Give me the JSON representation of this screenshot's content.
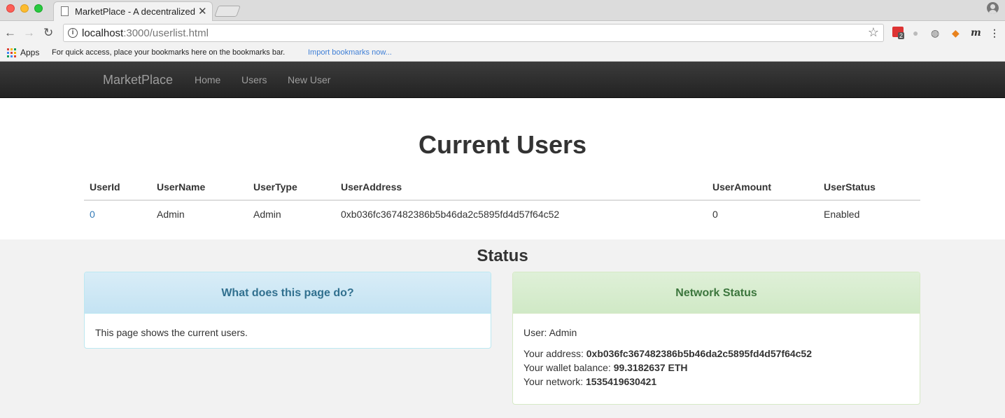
{
  "browser": {
    "tab_title": "MarketPlace - A decentralized",
    "url_host": "localhost",
    "url_rest": ":3000/userlist.html",
    "extension_badge": "2",
    "bookmarks": {
      "apps_label": "Apps",
      "hint": "For quick access, place your bookmarks here on the bookmarks bar.",
      "import_link": "Import bookmarks now..."
    }
  },
  "navbar": {
    "brand": "MarketPlace",
    "links": [
      "Home",
      "Users",
      "New User"
    ]
  },
  "page": {
    "title": "Current Users",
    "table": {
      "headers": [
        "UserId",
        "UserName",
        "UserType",
        "UserAddress",
        "UserAmount",
        "UserStatus"
      ],
      "rows": [
        [
          "0",
          "Admin",
          "Admin",
          "0xb036fc367482386b5b46da2c5895fd4d57f64c52",
          "0",
          "Enabled"
        ]
      ]
    }
  },
  "status": {
    "heading": "Status",
    "info_panel": {
      "title": "What does this page do?",
      "body": "This page shows the current users."
    },
    "network_panel": {
      "title": "Network Status",
      "user_line": "User: Admin",
      "address_label": "Your address:",
      "address_value": "0xb036fc367482386b5b46da2c5895fd4d57f64c52",
      "balance_label": "Your wallet balance:",
      "balance_value": "99.3182637 ETH",
      "network_label": "Your network:",
      "network_value": "1535419630421"
    }
  },
  "colors": {
    "navbar_bg": "#222222",
    "link": "#337ab7",
    "info_heading": "#31708f",
    "success_heading": "#3c763d"
  }
}
